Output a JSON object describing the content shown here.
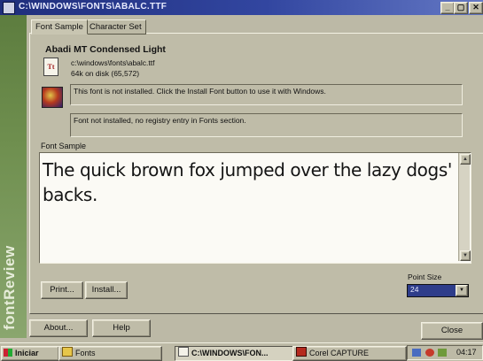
{
  "window": {
    "title": "C:\\WINDOWS\\FONTS\\ABALC.TTF",
    "minimize_glyph": "_",
    "maximize_glyph": "▢",
    "close_glyph": "✕"
  },
  "sidebar_brand": "fontReview",
  "tabs": [
    {
      "label": "Font Sample"
    },
    {
      "label": "Character Set"
    }
  ],
  "font_info": {
    "name": "Abadi MT Condensed Light",
    "icon_glyph": "Tt",
    "path": "c:\\windows\\fonts\\abalc.ttf",
    "size_on_disk": "64k on disk (65,572)"
  },
  "status": {
    "install_message": "This font is not installed. Click the Install Font button to use it with Windows.",
    "registry_message": "Font not installed, no registry entry in Fonts section."
  },
  "sample": {
    "label": "Font Sample",
    "text": "The quick brown fox jumped over the lazy dogs' backs."
  },
  "buttons": {
    "print": "Print...",
    "install": "Install...",
    "about": "About...",
    "help": "Help",
    "close": "Close"
  },
  "point_size": {
    "label": "Point Size",
    "value": "24"
  },
  "taskbar": {
    "start": "Iniciar",
    "items": [
      {
        "label": "Fonts"
      },
      {
        "label": "C:\\WINDOWS\\FON..."
      },
      {
        "label": "Corel CAPTURE"
      }
    ],
    "clock": "04:17"
  },
  "colors": {
    "titlebar": "#1f2e7c",
    "dialog_face": "#bfbca8",
    "brand_strip": "#6f8f4f",
    "selection": "#2e3d8a"
  }
}
